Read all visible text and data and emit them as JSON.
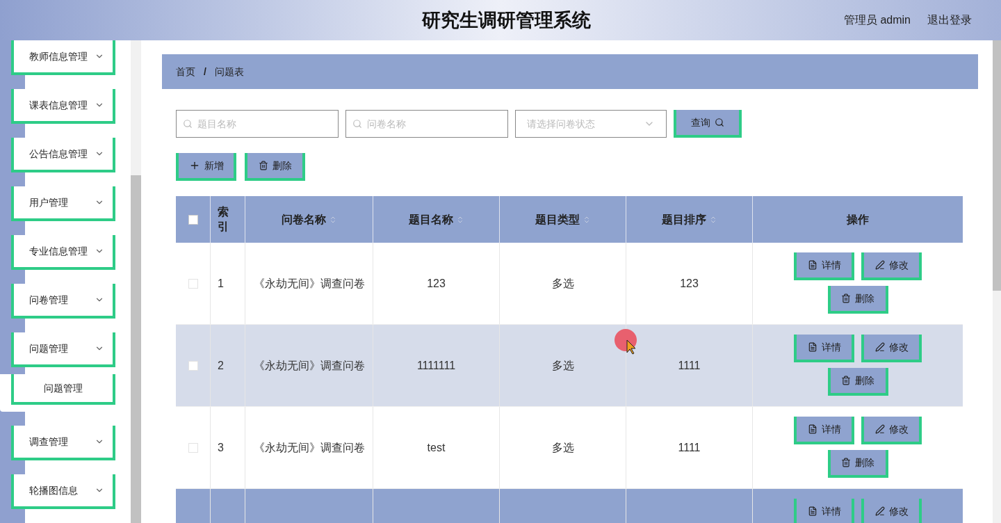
{
  "header": {
    "title": "研究生调研管理系统",
    "user": "管理员 admin",
    "logout": "退出登录"
  },
  "sidebar": {
    "items": [
      {
        "label": "教师信息管理"
      },
      {
        "label": "课表信息管理"
      },
      {
        "label": "公告信息管理"
      },
      {
        "label": "用户管理"
      },
      {
        "label": "专业信息管理"
      },
      {
        "label": "问卷管理"
      },
      {
        "label": "问题管理",
        "children": [
          {
            "label": "问题管理"
          }
        ]
      },
      {
        "label": "调查管理"
      },
      {
        "label": "轮播图信息"
      }
    ]
  },
  "breadcrumb": {
    "items": [
      "首页",
      "问题表"
    ],
    "separator": "/"
  },
  "filters": {
    "fields": [
      {
        "kind": "search",
        "placeholder": "题目名称"
      },
      {
        "kind": "search",
        "placeholder": "问卷名称"
      },
      {
        "kind": "select",
        "placeholder": "请选择问卷状态"
      }
    ],
    "query": "查询"
  },
  "toolbar": [
    {
      "kind": "add",
      "label": "新增"
    },
    {
      "kind": "delete",
      "label": "删除"
    }
  ],
  "table": {
    "header_checked": false,
    "columns": [
      {
        "label": "索引",
        "sortable": false
      },
      {
        "label": "问卷名称",
        "sortable": true
      },
      {
        "label": "题目名称",
        "sortable": true
      },
      {
        "label": "题目类型",
        "sortable": true
      },
      {
        "label": "题目排序",
        "sortable": true
      },
      {
        "label": "操作",
        "sortable": false
      }
    ],
    "rows": [
      {
        "kind": "plain",
        "checked": false,
        "cells": [
          "1",
          "《永劫无间》调查问卷",
          "123",
          "多选",
          "123"
        ],
        "actions": [
          {
            "kind": "detail",
            "label": "详情"
          },
          {
            "kind": "edit",
            "label": "修改"
          },
          {
            "kind": "delete",
            "label": "删除"
          }
        ]
      },
      {
        "kind": "hover",
        "checked": false,
        "cells": [
          "2",
          "《永劫无间》调查问卷",
          "1111111",
          "多选",
          "1111"
        ],
        "actions": [
          {
            "kind": "detail",
            "label": "详情"
          },
          {
            "kind": "edit",
            "label": "修改"
          },
          {
            "kind": "delete",
            "label": "删除"
          }
        ]
      },
      {
        "kind": "plain",
        "checked": false,
        "cells": [
          "3",
          "《永劫无间》调查问卷",
          "test",
          "多选",
          "1111"
        ],
        "actions": [
          {
            "kind": "detail",
            "label": "详情"
          },
          {
            "kind": "edit",
            "label": "修改"
          },
          {
            "kind": "delete",
            "label": "删除"
          }
        ]
      },
      {
        "kind": "stripe",
        "cells": [],
        "actions": [
          {
            "kind": "detail",
            "label": "详情"
          },
          {
            "kind": "edit",
            "label": "修改"
          }
        ]
      }
    ]
  }
}
